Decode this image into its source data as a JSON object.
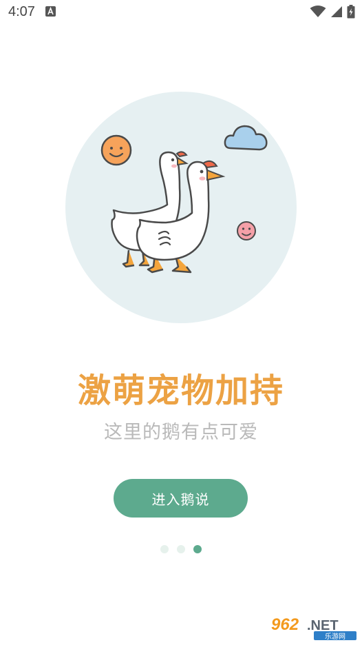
{
  "status_bar": {
    "time": "4:07",
    "icons": [
      "a-notification-icon",
      "wifi-icon",
      "cell-signal-icon",
      "battery-charging-icon"
    ]
  },
  "illustration": {
    "icons": [
      "geese-illustration",
      "smiley-sun-icon",
      "cloud-icon",
      "pink-smiley-icon"
    ]
  },
  "intro": {
    "headline": "激萌宠物加持",
    "subline": "这里的鹅有点可爱"
  },
  "enter_button": {
    "label": "进入鹅说"
  },
  "pager": {
    "count": 3,
    "active_index": 2
  },
  "colors": {
    "accent": "#5daa8e",
    "headline": "#eca244",
    "subline": "#b9b9b9",
    "circle_bg": "#e6f0f2"
  },
  "watermark": {
    "number": "962",
    "suffix": ".NET",
    "tagline": "乐游网"
  }
}
